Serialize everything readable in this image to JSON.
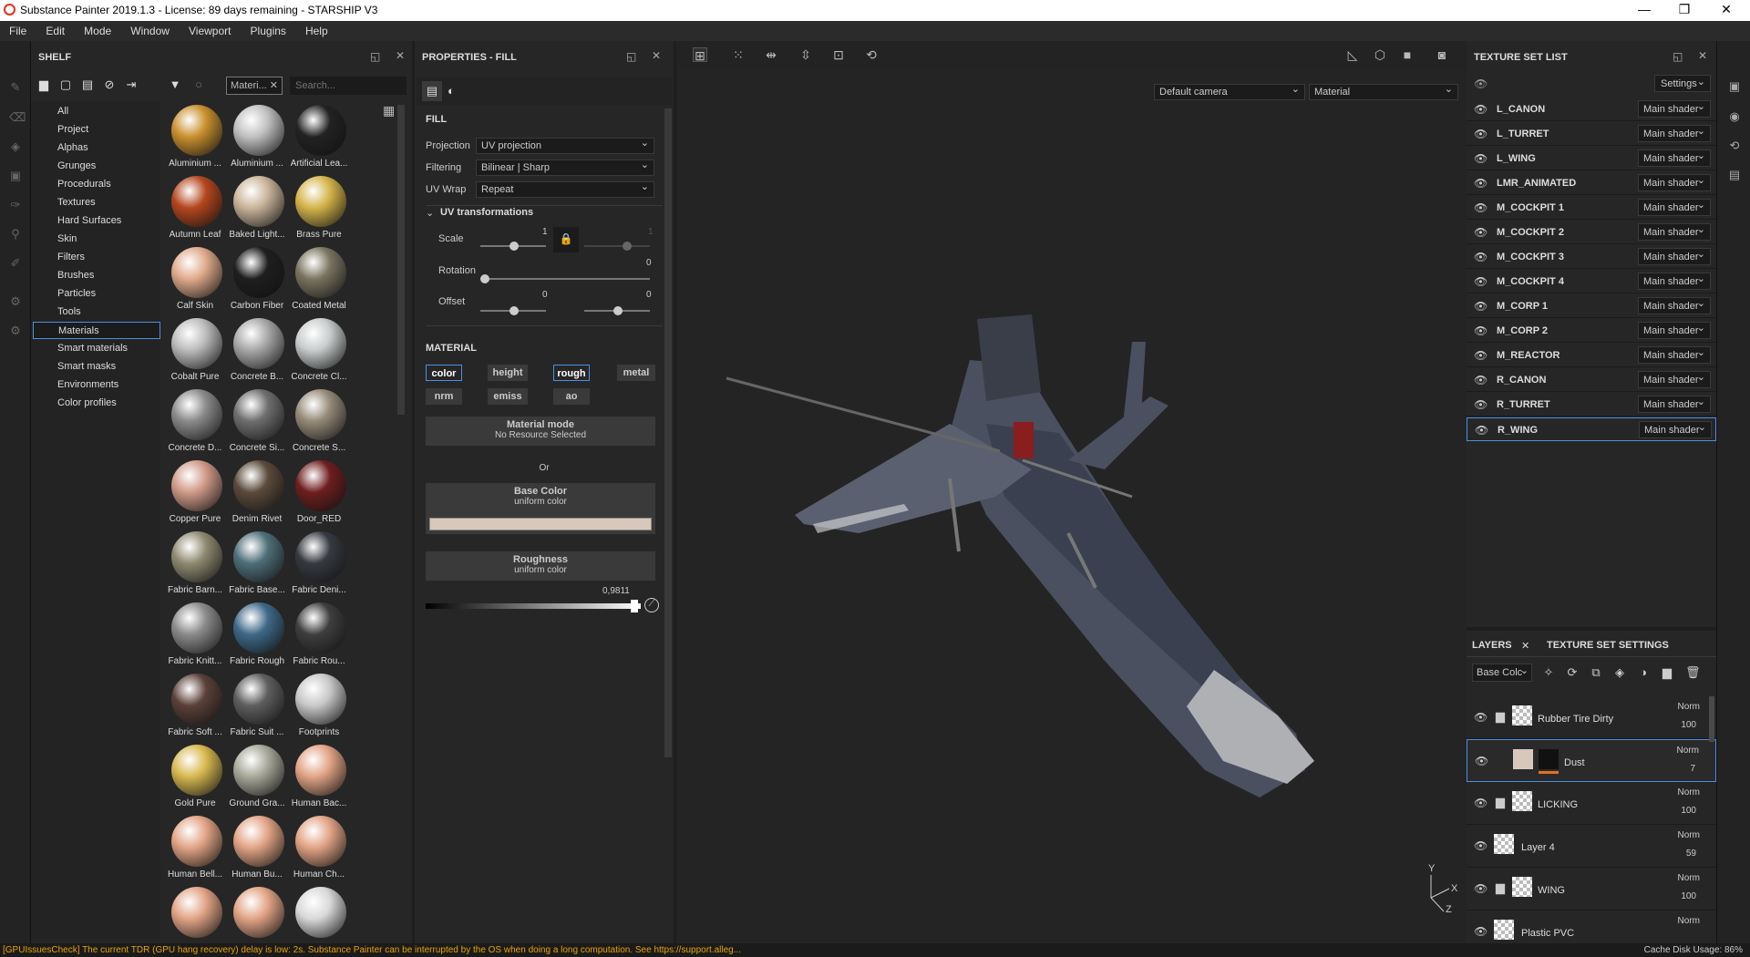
{
  "window": {
    "title": "Substance Painter 2019.1.3 - License: 89 days remaining - STARSHIP V3",
    "controls": [
      "—",
      "❐",
      "✕"
    ]
  },
  "menu": [
    "File",
    "Edit",
    "Mode",
    "Window",
    "Viewport",
    "Plugins",
    "Help"
  ],
  "shelf": {
    "title": "SHELF",
    "filter_chip": "Materi...",
    "search_placeholder": "Search...",
    "categories": [
      "All",
      "Project",
      "Alphas",
      "Grunges",
      "Procedurals",
      "Textures",
      "Hard Surfaces",
      "Skin",
      "Filters",
      "Brushes",
      "Particles",
      "Tools",
      "Materials",
      "Smart materials",
      "Smart masks",
      "Environments",
      "Color profiles"
    ],
    "selected_category": "Materials",
    "materials": [
      {
        "name": "Aluminium ...",
        "color": "#c9902e"
      },
      {
        "name": "Aluminium ...",
        "color": "#c0c0c0"
      },
      {
        "name": "Artificial Lea...",
        "color": "#222222"
      },
      {
        "name": "Autumn Leaf",
        "color": "#b4461e"
      },
      {
        "name": "Baked Light...",
        "color": "#c9b49a"
      },
      {
        "name": "Brass Pure",
        "color": "#d4b44a"
      },
      {
        "name": "Calf Skin",
        "color": "#e0aa8c"
      },
      {
        "name": "Carbon Fiber",
        "color": "#1e1e1e"
      },
      {
        "name": "Coated Metal",
        "color": "#7a7460"
      },
      {
        "name": "Cobalt Pure",
        "color": "#bcbcbc"
      },
      {
        "name": "Concrete B...",
        "color": "#a8a8a8"
      },
      {
        "name": "Concrete Cl...",
        "color": "#c8cccc"
      },
      {
        "name": "Concrete D...",
        "color": "#8a8a8a"
      },
      {
        "name": "Concrete Si...",
        "color": "#6e6e6e"
      },
      {
        "name": "Concrete S...",
        "color": "#958a78"
      },
      {
        "name": "Copper Pure",
        "color": "#d09a88"
      },
      {
        "name": "Denim Rivet",
        "color": "#5a4a3a"
      },
      {
        "name": "Door_RED",
        "color": "#6e1e1e"
      },
      {
        "name": "Fabric Barn...",
        "color": "#8e8a70"
      },
      {
        "name": "Fabric Base...",
        "color": "#4e6e78"
      },
      {
        "name": "Fabric Deni...",
        "color": "#363a40"
      },
      {
        "name": "Fabric Knitt...",
        "color": "#8a8a8a"
      },
      {
        "name": "Fabric Rough",
        "color": "#3e6888"
      },
      {
        "name": "Fabric Rou...",
        "color": "#3e3e3e"
      },
      {
        "name": "Fabric Soft ...",
        "color": "#5a4038"
      },
      {
        "name": "Fabric Suit ...",
        "color": "#5e5e5e"
      },
      {
        "name": "Footprints",
        "color": "#c8c8c8"
      },
      {
        "name": "Gold Pure",
        "color": "#d8b850"
      },
      {
        "name": "Ground Gra...",
        "color": "#a8a89a"
      },
      {
        "name": "Human Bac...",
        "color": "#e2a486"
      },
      {
        "name": "Human Bell...",
        "color": "#e2a486"
      },
      {
        "name": "Human Bu...",
        "color": "#e2a486"
      },
      {
        "name": "Human Ch...",
        "color": "#e2a486"
      },
      {
        "name": "",
        "color": "#e2a486"
      },
      {
        "name": "",
        "color": "#e2a486"
      },
      {
        "name": "",
        "color": "#d8d8d8"
      }
    ]
  },
  "properties": {
    "title": "PROPERTIES - FILL",
    "fill_header": "FILL",
    "projection_label": "Projection",
    "projection_value": "UV projection",
    "filtering_label": "Filtering",
    "filtering_value": "Bilinear | Sharp",
    "uvwrap_label": "UV Wrap",
    "uvwrap_value": "Repeat",
    "uv_header": "UV transformations",
    "scale_label": "Scale",
    "scale_value": "1",
    "scale_value2": "1",
    "rotation_label": "Rotation",
    "rotation_value": "0",
    "offset_label": "Offset",
    "offset_value1": "0",
    "offset_value2": "0",
    "material_header": "MATERIAL",
    "channels": [
      "color",
      "height",
      "rough",
      "metal",
      "nrm",
      "emiss",
      "ao"
    ],
    "material_mode_title": "Material mode",
    "material_mode_sub": "No Resource Selected",
    "or": "Or",
    "base_color_title": "Base Color",
    "base_color_sub": "uniform color",
    "base_color_swatch": "#d8c8bc",
    "roughness_title": "Roughness",
    "roughness_sub": "uniform color",
    "roughness_value": "0,9811"
  },
  "viewport": {
    "camera": "Default camera",
    "mode": "Material",
    "axis_labels": [
      "Y",
      "X",
      "Z"
    ]
  },
  "texture_sets": {
    "title": "TEXTURE SET LIST",
    "settings_label": "Settings",
    "rows": [
      {
        "name": "L_CANON",
        "shader": "Main shader"
      },
      {
        "name": "L_TURRET",
        "shader": "Main shader"
      },
      {
        "name": "L_WING",
        "shader": "Main shader"
      },
      {
        "name": "LMR_ANIMATED",
        "shader": "Main shader"
      },
      {
        "name": "M_COCKPIT 1",
        "shader": "Main shader"
      },
      {
        "name": "M_COCKPIT 2",
        "shader": "Main shader"
      },
      {
        "name": "M_COCKPIT 3",
        "shader": "Main shader"
      },
      {
        "name": "M_COCKPIT 4",
        "shader": "Main shader"
      },
      {
        "name": "M_CORP 1",
        "shader": "Main shader"
      },
      {
        "name": "M_CORP 2",
        "shader": "Main shader"
      },
      {
        "name": "M_REACTOR",
        "shader": "Main shader"
      },
      {
        "name": "R_CANON",
        "shader": "Main shader"
      },
      {
        "name": "R_TURRET",
        "shader": "Main shader"
      },
      {
        "name": "R_WING",
        "shader": "Main shader"
      }
    ],
    "selected": "R_WING"
  },
  "layers": {
    "tab_layers": "LAYERS",
    "tab_tss": "TEXTURE SET SETTINGS",
    "channel_dropdown": "Base Colc",
    "rows": [
      {
        "name": "Rubber Tire Dirty",
        "blend": "Norm",
        "opacity": "100",
        "folder": true
      },
      {
        "name": "Dust",
        "blend": "Norm",
        "opacity": "7",
        "folder": false
      },
      {
        "name": "LICKING",
        "blend": "Norm",
        "opacity": "100",
        "folder": true
      },
      {
        "name": "Layer 4",
        "blend": "Norm",
        "opacity": "59",
        "folder": false
      },
      {
        "name": "WING",
        "blend": "Norm",
        "opacity": "100",
        "folder": true
      },
      {
        "name": "Plastic PVC",
        "blend": "Norm",
        "opacity": "",
        "folder": false
      }
    ],
    "selected": "Dust"
  },
  "status": {
    "message": "[GPUIssuesCheck] The current TDR (GPU hang recovery) delay is low: 2s. Substance Painter can be interrupted by the OS when doing a long computation. See https://support.alleg...",
    "cache": "Cache Disk Usage:   86%"
  }
}
